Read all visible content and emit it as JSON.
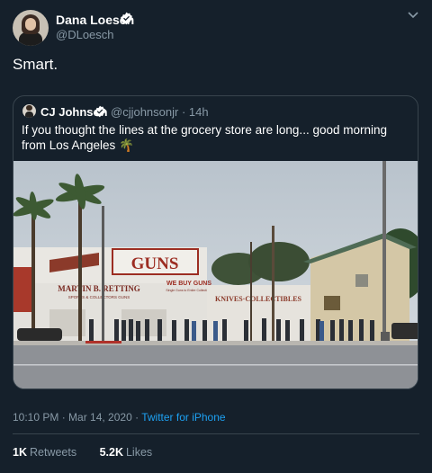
{
  "author": {
    "name": "Dana Loesch",
    "handle": "@DLoesch"
  },
  "tweet": {
    "text": "Smart."
  },
  "quoted": {
    "name": "CJ Johnson",
    "handle": "@cjjohnsonjr",
    "time": "14h",
    "text": "If you thought the lines at the grocery store are long... good morning from Los Angeles 🌴"
  },
  "image_signs": {
    "main": "GUNS",
    "sub": "WE BUY GUNS",
    "sub2": "Single Guns to Entire Collections",
    "store": "MARTIN B. RETTING",
    "store2": "SPORTS & COLLECTORS GUNS",
    "right": "KNIVES·COLLECTIBLES"
  },
  "meta": {
    "timestamp": "10:10 PM · Mar 14, 2020 ·",
    "client": "Twitter for iPhone"
  },
  "stats": {
    "retweets_value": "1K",
    "retweets_label": "Retweets",
    "likes_value": "5.2K",
    "likes_label": "Likes"
  },
  "colors": {
    "background": "#15202b",
    "secondary_text": "#8899a6",
    "link": "#1da1f2",
    "border": "#38444d"
  }
}
